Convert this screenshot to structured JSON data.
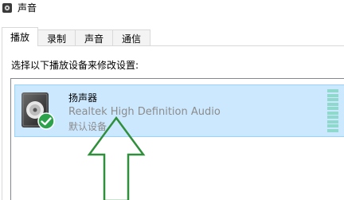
{
  "window": {
    "title": "声音",
    "icon": "speaker-small-icon"
  },
  "tabs": [
    {
      "label": "播放",
      "active": true
    },
    {
      "label": "录制",
      "active": false
    },
    {
      "label": "声音",
      "active": false
    },
    {
      "label": "通信",
      "active": false
    }
  ],
  "playback": {
    "instruction": "选择以下播放设备来修改设置:",
    "devices": [
      {
        "name": "扬声器",
        "description": "Realtek High Definition Audio",
        "status": "默认设备",
        "icon": "speaker-icon",
        "badge": "default-check-icon",
        "selected": true
      }
    ]
  },
  "colors": {
    "selection": "#cce8ff",
    "selection_border": "#99d1ff",
    "check_green": "#2ca24b",
    "arrow_green": "#2f8f3a",
    "meter": "#8fd9cc"
  }
}
